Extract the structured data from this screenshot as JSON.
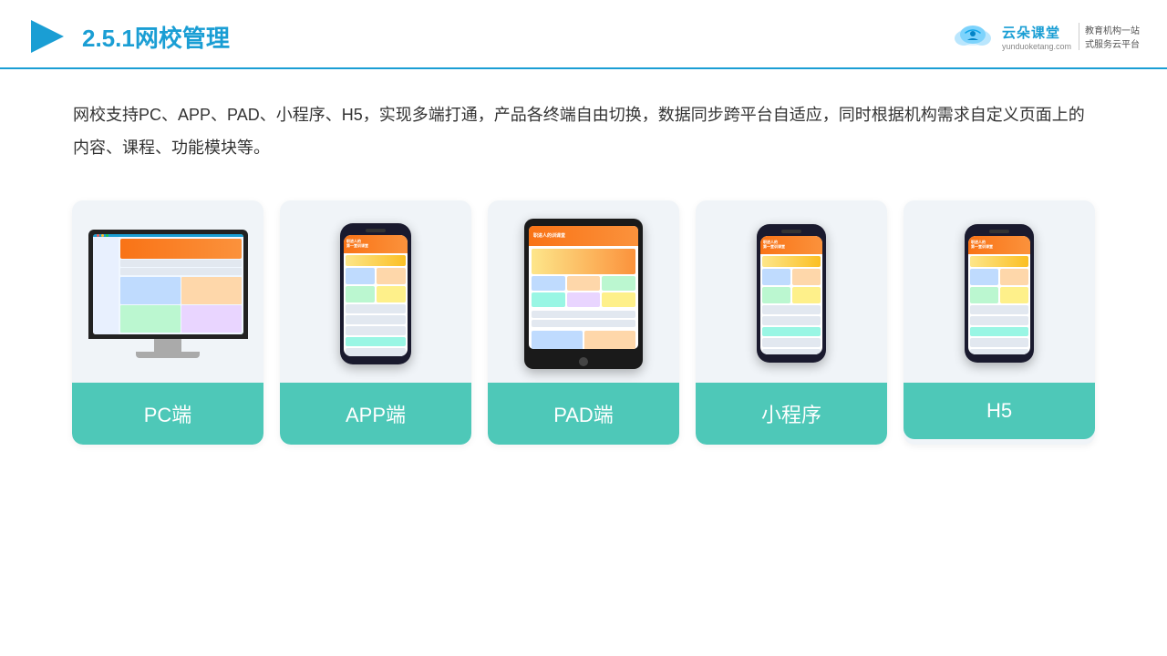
{
  "header": {
    "section": "2.5.1",
    "title": "网校管理",
    "logo_main": "云朵课堂",
    "logo_url": "yunduoketang.com",
    "logo_tag1": "教育机构一站",
    "logo_tag2": "式服务云平台"
  },
  "description": {
    "text": "网校支持PC、APP、PAD、小程序、H5，实现多端打通，产品各终端自由切换，数据同步跨平台自适应，同时根据机构需求自定义页面上的内容、课程、功能模块等。"
  },
  "cards": [
    {
      "id": "pc",
      "label": "PC端"
    },
    {
      "id": "app",
      "label": "APP端"
    },
    {
      "id": "pad",
      "label": "PAD端"
    },
    {
      "id": "miniprogram",
      "label": "小程序"
    },
    {
      "id": "h5",
      "label": "H5"
    }
  ],
  "colors": {
    "accent": "#1a9ed4",
    "card_label_bg": "#4ec8b8",
    "title_color": "#333",
    "border_color": "#1a9ed4"
  }
}
